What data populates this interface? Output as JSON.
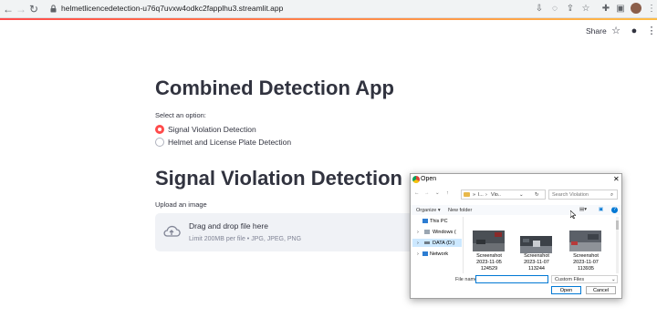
{
  "browser": {
    "url": "helmetlicencedetection-u76q7uvxw4odkc2fapplhu3.streamlit.app"
  },
  "header": {
    "share_label": "Share"
  },
  "main": {
    "app_title": "Combined Detection App",
    "radio_group_label": "Select an option:",
    "options": [
      {
        "label": "Signal Violation Detection",
        "selected": true
      },
      {
        "label": "Helmet and License Plate Detection",
        "selected": false
      }
    ],
    "section_title": "Signal Violation Detection",
    "upload_label": "Upload an image",
    "dropzone_title": "Drag and drop file here",
    "dropzone_subtitle": "Limit 200MB per file • JPG, JPEG, PNG"
  },
  "dialog": {
    "title": "Open",
    "breadcrumb_prefix": "l...",
    "breadcrumb_current": "Vio..",
    "search_placeholder": "Search Violation",
    "organize_label": "Organize ▾",
    "new_folder_label": "New folder",
    "sidebar_items": [
      {
        "label": "This PC"
      },
      {
        "label": "Windows ("
      },
      {
        "label": "DATA (D:)"
      },
      {
        "label": "Network"
      }
    ],
    "files": [
      {
        "name": "Screenshot",
        "line2": "2023-11-05",
        "line3": "124529"
      },
      {
        "name": "Screenshot",
        "line2": "2023-11-07",
        "line3": "113244"
      },
      {
        "name": "Screenshot",
        "line2": "2023-11-07",
        "line3": "113935"
      }
    ],
    "file_name_label": "File name:",
    "file_name_value": "",
    "filter_value": "Custom Files",
    "open_label": "Open",
    "cancel_label": "Cancel"
  },
  "colors": {
    "accent": "#ff4b4b",
    "dropzone_bg": "#f0f2f6",
    "text": "#31333f"
  }
}
